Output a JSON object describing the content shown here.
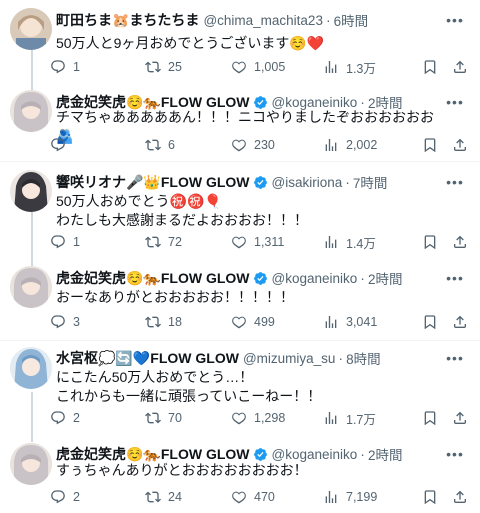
{
  "tweets": [
    {
      "name": "町田ちま🐹まちたちま",
      "handle": "@chima_machita23",
      "time": "6時間",
      "verified": false,
      "text": "50万人と9ヶ月おめでとうございます☺️❤️",
      "replies": "1",
      "retweets": "25",
      "likes": "1,005",
      "views": "1.3万"
    },
    {
      "name": "虎金妃笑虎☺️🐅FLOW GLOW",
      "handle": "@koganeiniko",
      "time": "2時間",
      "verified": true,
      "text": "チマちゃあああああん！！！ニコやりましたぞおおおおおお🫂",
      "replies": "",
      "retweets": "6",
      "likes": "230",
      "views": "2,002"
    },
    {
      "name": "響咲リオナ🎤👑FLOW GLOW",
      "handle": "@isakiriona",
      "time": "7時間",
      "verified": true,
      "text": "50万人おめでとう㊗️㊗️🎈\nわたしも大感謝まるだよおおおお！！！",
      "replies": "1",
      "retweets": "72",
      "likes": "1,311",
      "views": "1.4万"
    },
    {
      "name": "虎金妃笑虎☺️🐅FLOW GLOW",
      "handle": "@koganeiniko",
      "time": "2時間",
      "verified": true,
      "text": "おーなありがとおおおおお！！！！！",
      "replies": "3",
      "retweets": "18",
      "likes": "499",
      "views": "3,041"
    },
    {
      "name": "水宮枢💭🔄💙FLOW GLOW",
      "handle": "@mizumiya_su",
      "time": "8時間",
      "verified": false,
      "text": "にこたん50万人おめでとう…！\nこれからも一緒に頑張っていこーねー！！",
      "replies": "2",
      "retweets": "70",
      "likes": "1,298",
      "views": "1.7万"
    },
    {
      "name": "虎金妃笑虎☺️🐅FLOW GLOW",
      "handle": "@koganeiniko",
      "time": "2時間",
      "verified": true,
      "text": "すぅちゃんありがとおおおおおおおお！",
      "replies": "2",
      "retweets": "24",
      "likes": "470",
      "views": "7,199"
    }
  ],
  "colors": {
    "text": "#0f1419",
    "muted": "#536471",
    "verified": "#1d9bf0",
    "divider": "#eff3f4",
    "thread": "#cfd9de"
  },
  "icons": {
    "reply": "reply-icon",
    "retweet": "retweet-icon",
    "like": "like-icon",
    "views": "views-icon",
    "bookmark": "bookmark-icon",
    "share": "share-icon",
    "more": "more-icon",
    "verified": "verified-badge-icon"
  }
}
